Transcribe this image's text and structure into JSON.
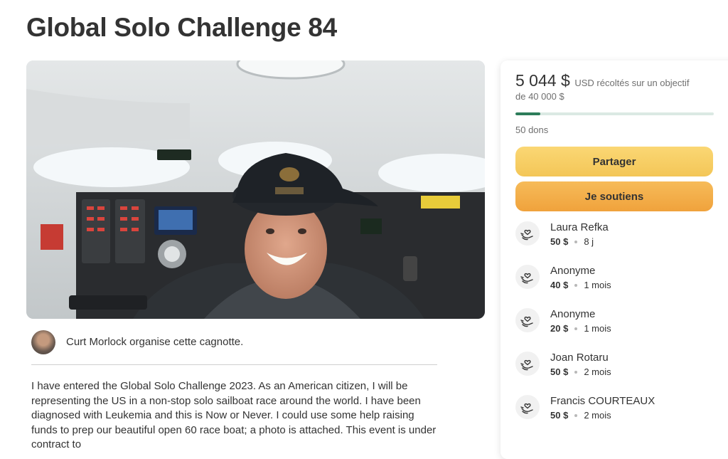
{
  "campaign": {
    "title": "Global Solo Challenge 84",
    "hero_image": "Skipper in USMC cap taking selfie inside sailboat cabin"
  },
  "organizer": {
    "text": "Curt Morlock organise cette cagnotte."
  },
  "story": {
    "text": "I have entered the Global Solo Challenge 2023. As an American citizen, I will be representing the US in a non-stop solo sailboat race around the world. I have been diagnosed with Leukemia and this is Now or Never. I could use some help raising funds to prep our beautiful open 60 race boat; a photo is attached. This event is under contract to"
  },
  "progress": {
    "amount": "5 044 $",
    "caption": "USD récoltés sur un objectif de 40 000 $",
    "fraction": 0.126,
    "count_label": "50 dons"
  },
  "actions": {
    "share_label": "Partager",
    "donate_label": "Je soutiens"
  },
  "donations": [
    {
      "name": "Laura Refka",
      "amount": "50 $",
      "time": "8 j"
    },
    {
      "name": "Anonyme",
      "amount": "40 $",
      "time": "1 mois"
    },
    {
      "name": "Anonyme",
      "amount": "20 $",
      "time": "1 mois"
    },
    {
      "name": "Joan Rotaru",
      "amount": "50 $",
      "time": "2 mois"
    },
    {
      "name": "Francis COURTEAUX",
      "amount": "50 $",
      "time": "2 mois"
    }
  ],
  "colors": {
    "progress_fill": "#2d7d5a",
    "share_button": "#f7cf64",
    "donate_button": "#f3ad47"
  }
}
